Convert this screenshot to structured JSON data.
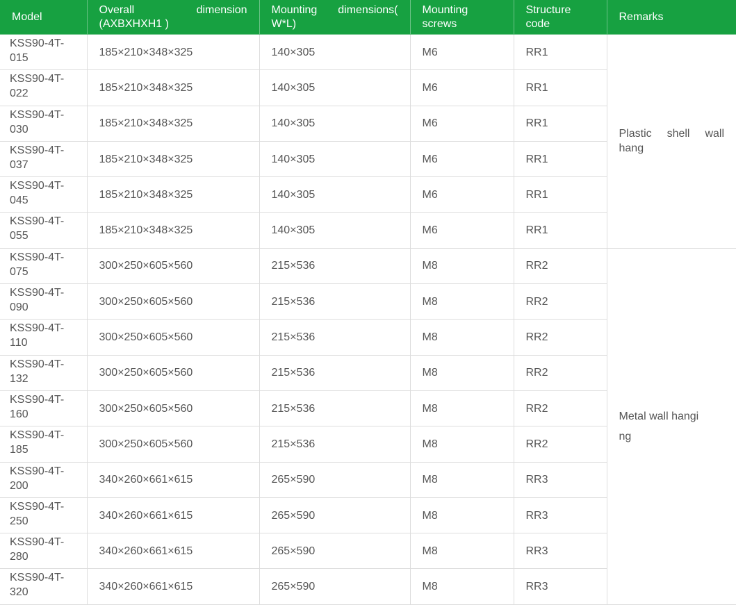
{
  "table": {
    "headers": {
      "model": "Model",
      "overall": "Overall dimension (AXBXHXH1 )",
      "mounting": "Mounting dimensions( W*L)",
      "screws": "Mounting screws",
      "structure": "Structure code",
      "remarks": "Remarks"
    },
    "rows": [
      [
        "KSS90-4T-015",
        "185×210×348×325",
        "140×305",
        "M6",
        "RR1"
      ],
      [
        "KSS90-4T-022",
        "185×210×348×325",
        "140×305",
        "M6",
        "RR1"
      ],
      [
        "KSS90-4T-030",
        "185×210×348×325",
        "140×305",
        "M6",
        "RR1"
      ],
      [
        "KSS90-4T-037",
        "185×210×348×325",
        "140×305",
        "M6",
        "RR1"
      ],
      [
        "KSS90-4T-045",
        "185×210×348×325",
        "140×305",
        "M6",
        "RR1"
      ],
      [
        "KSS90-4T-055",
        "185×210×348×325",
        "140×305",
        "M6",
        "RR1"
      ],
      [
        "KSS90-4T-075",
        "300×250×605×560",
        "215×536",
        "M8",
        "RR2"
      ],
      [
        "KSS90-4T-090",
        "300×250×605×560",
        "215×536",
        "M8",
        "RR2"
      ],
      [
        "KSS90-4T-110",
        "300×250×605×560",
        "215×536",
        "M8",
        "RR2"
      ],
      [
        "KSS90-4T-132",
        "300×250×605×560",
        "215×536",
        "M8",
        "RR2"
      ],
      [
        "KSS90-4T-160",
        "300×250×605×560",
        "215×536",
        "M8",
        "RR2"
      ],
      [
        "KSS90-4T-185",
        "300×250×605×560",
        "215×536",
        "M8",
        "RR2"
      ],
      [
        "KSS90-4T-200",
        "340×260×661×615",
        "265×590",
        "M8",
        "RR3"
      ],
      [
        "KSS90-4T-250",
        "340×260×661×615",
        "265×590",
        "M8",
        "RR3"
      ],
      [
        "KSS90-4T-280",
        "340×260×661×615",
        "265×590",
        "M8",
        "RR3"
      ],
      [
        "KSS90-4T-320",
        "340×260×661×615",
        "265×590",
        "M8",
        "RR3"
      ]
    ],
    "remarks": [
      "Plastic shell wall hang",
      "Metal wall hanging"
    ]
  },
  "colors": {
    "header_bg": "#17a141",
    "header_text": "#ffffff",
    "body_text": "#555555",
    "border": "#dddddd"
  }
}
